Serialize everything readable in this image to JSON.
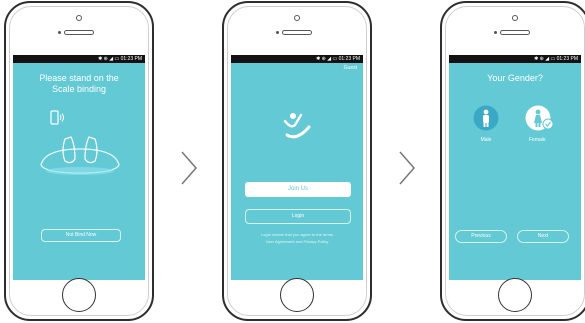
{
  "colors": {
    "screen": "#63c9d5",
    "statusbar": "#121212",
    "outline": "#2e2e2e"
  },
  "screen1": {
    "status": "✱ ⊕ ◢ ▭ 01:23 PM",
    "title_line1": "Please stand on the",
    "title_line2": "Scale binding",
    "not_bind_button": "Not Bind Now",
    "icons": [
      "phone-signal-icon",
      "feet-on-scale-icon"
    ]
  },
  "screen2": {
    "status": "✱ ⊕ ◢ ▭ 01:23 PM",
    "top_right": "Guest",
    "join_button": "Join Us",
    "login_button": "Login",
    "small_text": "Login means that you agree to the terms",
    "terms_text": "User Agreement and Privacy Policy",
    "icons": [
      "app-logo-icon"
    ]
  },
  "screen3": {
    "status": "✱ ⊕ ◢ ▭ 01:23 PM",
    "title": "Your Gender?",
    "male_label": "Male",
    "female_label": "Female",
    "previous_button": "Previous",
    "next_button": "Next",
    "icons": [
      "male-icon",
      "female-icon",
      "check-icon"
    ]
  },
  "arrows": [
    "chevron-right-icon",
    "chevron-right-icon"
  ]
}
